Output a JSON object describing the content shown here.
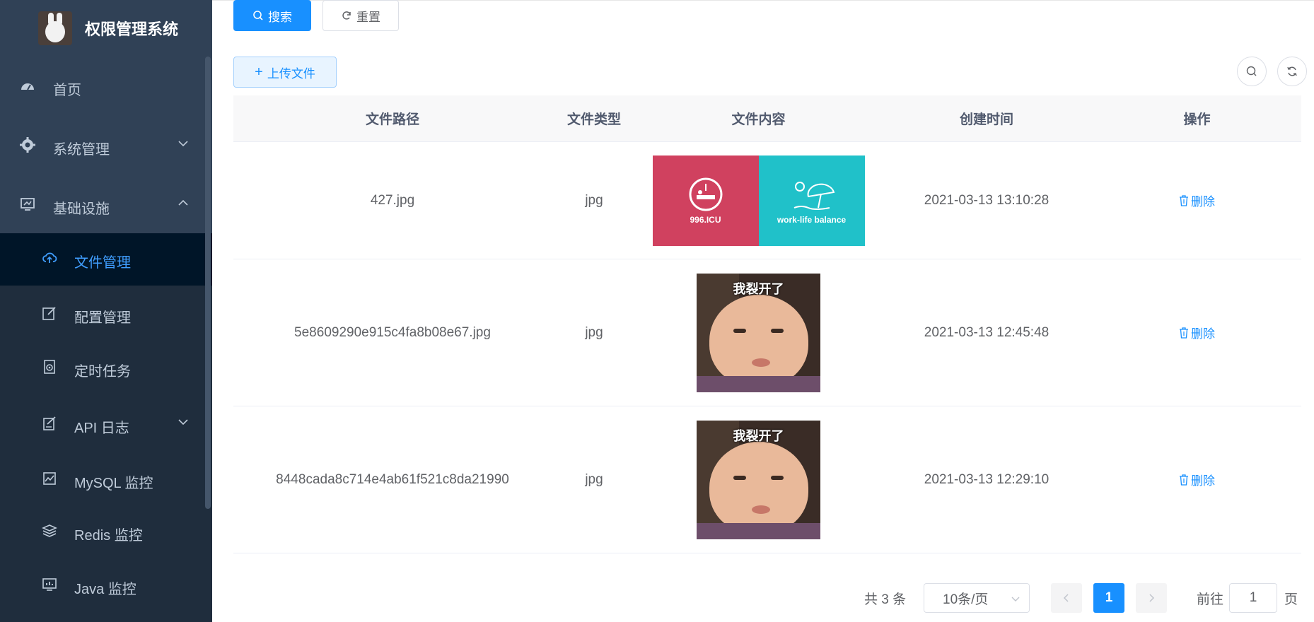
{
  "app": {
    "title": "权限管理系统"
  },
  "sidebar": {
    "items": [
      {
        "label": "首页",
        "icon": "dashboard-icon"
      },
      {
        "label": "系统管理",
        "icon": "gear-icon"
      },
      {
        "label": "基础设施",
        "icon": "monitor-icon"
      },
      {
        "label": "文件管理",
        "icon": "cloud-upload-icon"
      },
      {
        "label": "配置管理",
        "icon": "edit-icon"
      },
      {
        "label": "定时任务",
        "icon": "timer-icon"
      },
      {
        "label": "API 日志",
        "icon": "log-icon"
      },
      {
        "label": "MySQL 监控",
        "icon": "chart-icon"
      },
      {
        "label": "Redis 监控",
        "icon": "layers-icon"
      },
      {
        "label": "Java 监控",
        "icon": "monitor-chart-icon"
      }
    ]
  },
  "toolbar": {
    "search_label": "搜索",
    "reset_label": "重置",
    "upload_label": "上传文件"
  },
  "table": {
    "headers": [
      "文件路径",
      "文件类型",
      "文件内容",
      "创建时间",
      "操作"
    ],
    "rows": [
      {
        "path": "427.jpg",
        "type": "jpg",
        "created": "2021-03-13 13:10:28",
        "action": "删除",
        "image": {
          "left_caption": "996.ICU",
          "right_caption": "work-life balance"
        }
      },
      {
        "path": "5e8609290e915c4fa8b08e67.jpg",
        "type": "jpg",
        "created": "2021-03-13 12:45:48",
        "action": "删除",
        "image": {
          "caption": "我裂开了"
        }
      },
      {
        "path": "8448cada8c714e4ab61f521c8da21990",
        "type": "jpg",
        "created": "2021-03-13 12:29:10",
        "action": "删除",
        "image": {
          "caption": "我裂开了"
        }
      }
    ]
  },
  "pagination": {
    "total": "共 3 条",
    "page_size": "10条/页",
    "current_page": "1",
    "goto_label": "前往",
    "goto_value": "1",
    "page_suffix": "页"
  },
  "colors": {
    "primary": "#1890ff",
    "sidebar_bg": "#304156",
    "active_bg": "#001528"
  }
}
